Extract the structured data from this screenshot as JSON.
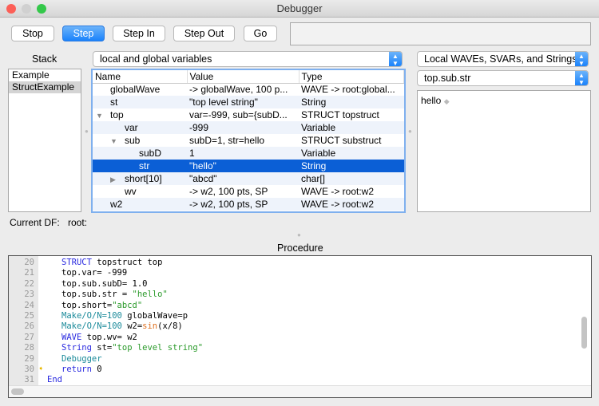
{
  "window": {
    "title": "Debugger"
  },
  "toolbar": {
    "stop": "Stop",
    "step": "Step",
    "step_in": "Step In",
    "step_out": "Step Out",
    "go": "Go",
    "message": ""
  },
  "stack": {
    "label": "Stack",
    "items": [
      "Example",
      "StructExample"
    ],
    "selected": 1
  },
  "variables": {
    "scope_popup": "local and global variables",
    "columns": [
      "Name",
      "Value",
      "Type"
    ],
    "rows": [
      {
        "name": "globalWave",
        "value": "-> globalWave, 100 p...",
        "type": "WAVE -> root:global...",
        "indent": 0,
        "disclosure": ""
      },
      {
        "name": "st",
        "value": "\"top level string\"",
        "type": "String",
        "indent": 0,
        "disclosure": ""
      },
      {
        "name": "top",
        "value": "var=-999, sub={subD...",
        "type": "STRUCT topstruct",
        "indent": 0,
        "disclosure": "expanded"
      },
      {
        "name": "var",
        "value": "-999",
        "type": "Variable",
        "indent": 1,
        "disclosure": ""
      },
      {
        "name": "sub",
        "value": "subD=1, str=hello",
        "type": "STRUCT substruct",
        "indent": 1,
        "disclosure": "expanded"
      },
      {
        "name": "subD",
        "value": "1",
        "type": "Variable",
        "indent": 2,
        "disclosure": ""
      },
      {
        "name": "str",
        "value": "\"hello\"",
        "type": "String",
        "indent": 2,
        "disclosure": "",
        "selected": true
      },
      {
        "name": "short[10]",
        "value": "\"abcd\"",
        "type": "char[]",
        "indent": 1,
        "disclosure": "collapsed"
      },
      {
        "name": "wv",
        "value": "-> w2, 100 pts, SP",
        "type": "WAVE -> root:w2",
        "indent": 1,
        "disclosure": ""
      },
      {
        "name": "w2",
        "value": "-> w2, 100 pts, SP",
        "type": "WAVE -> root:w2",
        "indent": 0,
        "disclosure": ""
      }
    ]
  },
  "inspector": {
    "kind_popup": "Local WAVEs, SVARs, and Strings",
    "item_popup": "top.sub.str",
    "content": "hello"
  },
  "current_df": {
    "label": "Current DF:",
    "value": "root:"
  },
  "procedure": {
    "label": "Procedure",
    "current_line": 30,
    "lines": [
      {
        "n": "20",
        "parts": [
          [
            "kw",
            "STRUCT"
          ],
          [
            "",
            "topstruct top"
          ]
        ]
      },
      {
        "n": "21",
        "parts": [
          [
            "",
            "top.var= -999"
          ]
        ]
      },
      {
        "n": "22",
        "parts": [
          [
            "",
            "top.sub.subD= 1.0"
          ]
        ]
      },
      {
        "n": "23",
        "parts": [
          [
            "",
            "top.sub.str = "
          ],
          [
            "str",
            "\"hello\""
          ]
        ]
      },
      {
        "n": "24",
        "parts": [
          [
            "",
            "top.short="
          ],
          [
            "str",
            "\"abcd\""
          ]
        ]
      },
      {
        "n": "25",
        "parts": [
          [
            "op",
            "Make/O/N=100"
          ],
          [
            "",
            "globalWave=p"
          ]
        ]
      },
      {
        "n": "26",
        "parts": [
          [
            "op",
            "Make/O/N=100"
          ],
          [
            "",
            "w2="
          ],
          [
            "fn",
            "sin"
          ],
          [
            "",
            "(x/8)"
          ]
        ]
      },
      {
        "n": "27",
        "parts": [
          [
            "kw",
            "WAVE"
          ],
          [
            "",
            "top.wv= w2"
          ]
        ]
      },
      {
        "n": "28",
        "parts": [
          [
            "kw",
            "String"
          ],
          [
            "",
            "st="
          ],
          [
            "str",
            "\"top level string\""
          ]
        ]
      },
      {
        "n": "29",
        "parts": [
          [
            "op",
            "Debugger"
          ]
        ]
      },
      {
        "n": "30",
        "parts": [
          [
            "kw",
            "return"
          ],
          [
            "",
            "0"
          ]
        ]
      },
      {
        "n": "31",
        "parts": [
          [
            "kw",
            "End"
          ]
        ]
      }
    ]
  }
}
